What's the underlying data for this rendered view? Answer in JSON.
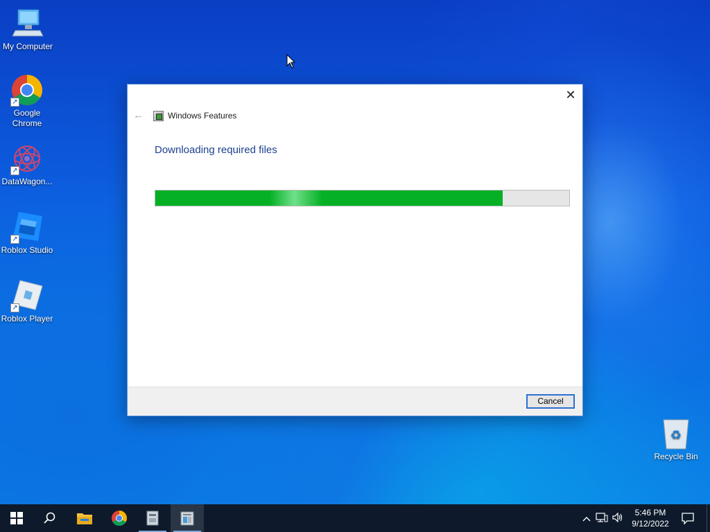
{
  "desktop": {
    "icons": [
      {
        "label": "My Computer",
        "icon": "computer-icon"
      },
      {
        "label": "Google Chrome",
        "icon": "chrome-icon"
      },
      {
        "label": "DataWagon...",
        "icon": "datawagon-icon"
      },
      {
        "label": "Roblox Studio",
        "icon": "roblox-studio-icon"
      },
      {
        "label": "Roblox Player",
        "icon": "roblox-player-icon"
      }
    ],
    "recycle_bin": {
      "label": "Recycle Bin",
      "icon": "recycle-bin-icon"
    }
  },
  "dialog": {
    "title": "Windows Features",
    "heading": "Downloading required files",
    "progress": 0.84,
    "cancel_label": "Cancel",
    "close_symbol": "✕",
    "back_symbol": "←"
  },
  "taskbar": {
    "items": [
      "start-icon",
      "search-icon",
      "file-explorer-icon",
      "chrome-icon",
      "app-icon",
      "windows-features-icon"
    ],
    "clock": {
      "time": "5:46 PM",
      "date": "9/12/2022"
    }
  },
  "colors": {
    "heading": "#1d3f8f",
    "progress_fill": "#06b025",
    "taskbar": "#0e1a2b"
  }
}
